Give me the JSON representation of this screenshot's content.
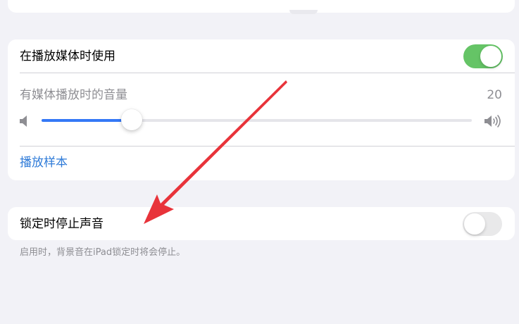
{
  "media_section": {
    "use_during_media_label": "在播放媒体时使用",
    "use_during_media_enabled": true,
    "volume_label": "有媒体播放时的音量",
    "volume_value": "20",
    "volume_fraction": 0.21,
    "play_sample_label": "播放样本"
  },
  "lock_section": {
    "stop_on_lock_label": "锁定时停止声音",
    "stop_on_lock_enabled": false,
    "footnote": "启用时，背景音在iPad锁定时将会停止。"
  },
  "colors": {
    "background": "#f2f2f7",
    "toggle_on": "#65c466",
    "toggle_off": "#e9e9ea",
    "slider_fill": "#3478f6",
    "link": "#2f7bd8",
    "annotation_arrow": "#e8333a"
  },
  "icons": {
    "volume_low": "speaker-low-icon",
    "volume_high": "speaker-high-icon",
    "annotation": "red-arrow-icon"
  }
}
